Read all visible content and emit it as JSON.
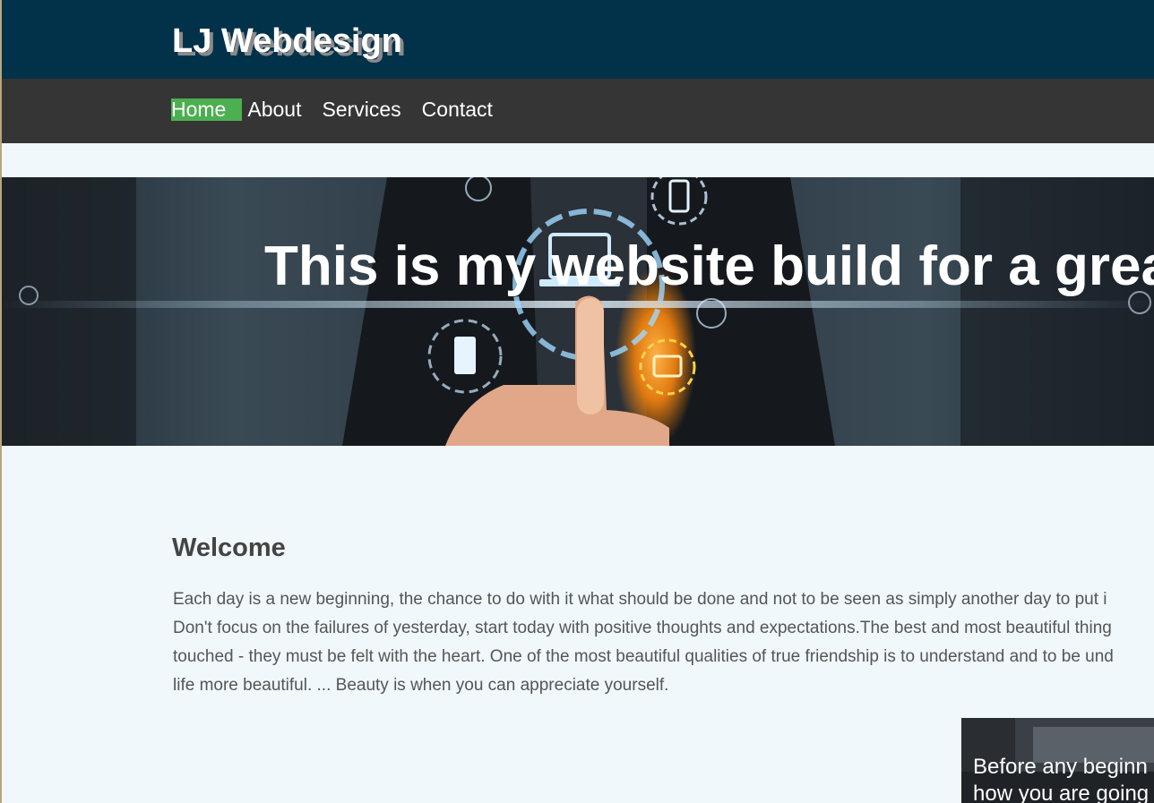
{
  "header": {
    "brand": "LJ Webdesign"
  },
  "nav": {
    "items": [
      {
        "label": "Home",
        "active": true
      },
      {
        "label": "About",
        "active": false
      },
      {
        "label": "Services",
        "active": false
      },
      {
        "label": "Contact",
        "active": false
      }
    ]
  },
  "hero": {
    "headline": "This is my website build for a grea"
  },
  "welcome": {
    "title": "Welcome",
    "lines": [
      "Each day is a new beginning, the chance to do with it what should be done and not to be seen as simply another day to put i",
      "Don't focus on the failures of yesterday, start today with positive thoughts and expectations.The best and most beautiful thing",
      "touched - they must be felt with the heart. One of the most beautiful qualities of true friendship is to understand and to be und",
      "life more beautiful. ... Beauty is when you can appreciate yourself."
    ]
  },
  "card": {
    "line1": "Before any beginn",
    "line2": "how you are going"
  },
  "colors": {
    "topbar": "#02314a",
    "navbar": "#353535",
    "nav_active": "#4caf50",
    "page_bg": "#f0f8fc"
  }
}
